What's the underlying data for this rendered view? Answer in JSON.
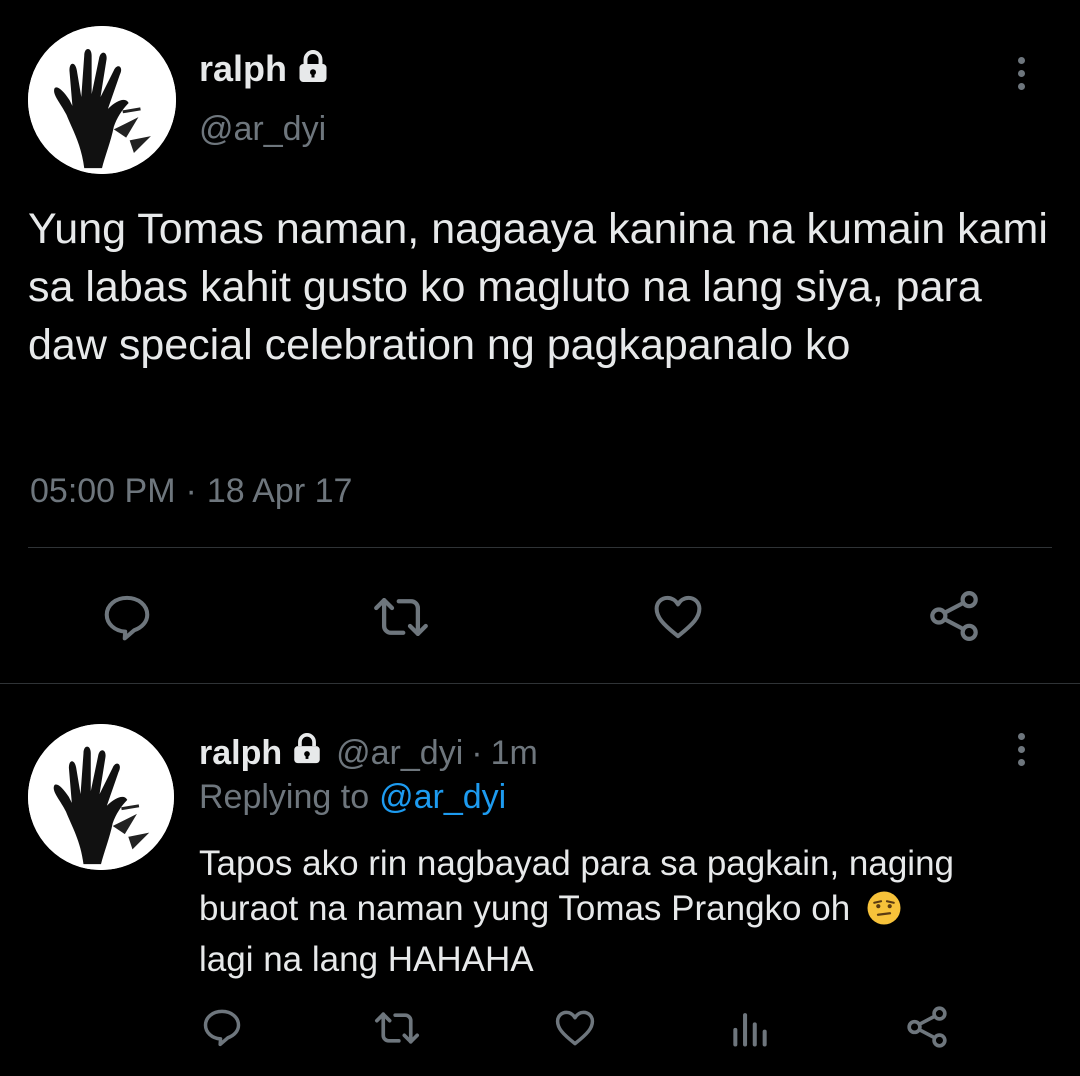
{
  "main_tweet": {
    "name": "ralph",
    "handle": "@ar_dyi",
    "text": "Yung Tomas naman, nagaaya kanina na kumain kami sa labas kahit gusto ko magluto na lang siya, para daw special celebration ng pagkapanalo ko",
    "time": "05:00 PM",
    "separator": "·",
    "date": "18 Apr 17",
    "icons": [
      "lock-icon",
      "more-icon",
      "reply-icon",
      "retweet-icon",
      "like-icon",
      "share-icon"
    ]
  },
  "reply_tweet": {
    "name": "ralph",
    "handle": "@ar_dyi",
    "separator": "·",
    "age": "1m",
    "replying_label": "Replying to",
    "replying_handle": "@ar_dyi",
    "text_line1": "Tapos ako rin nagbayad para sa pagkain, naging",
    "text_line2": "buraot na naman yung Tomas Prangko oh",
    "text_line3": "lagi na lang HAHAHA",
    "emoji": "😒",
    "icons": [
      "lock-icon",
      "more-icon",
      "reply-icon",
      "retweet-icon",
      "like-icon",
      "analytics-icon",
      "share-icon"
    ]
  },
  "colors": {
    "background": "#000000",
    "text": "#e7e9ea",
    "muted": "#6e767d",
    "link": "#1d9bf0",
    "divider": "#2f3336"
  }
}
